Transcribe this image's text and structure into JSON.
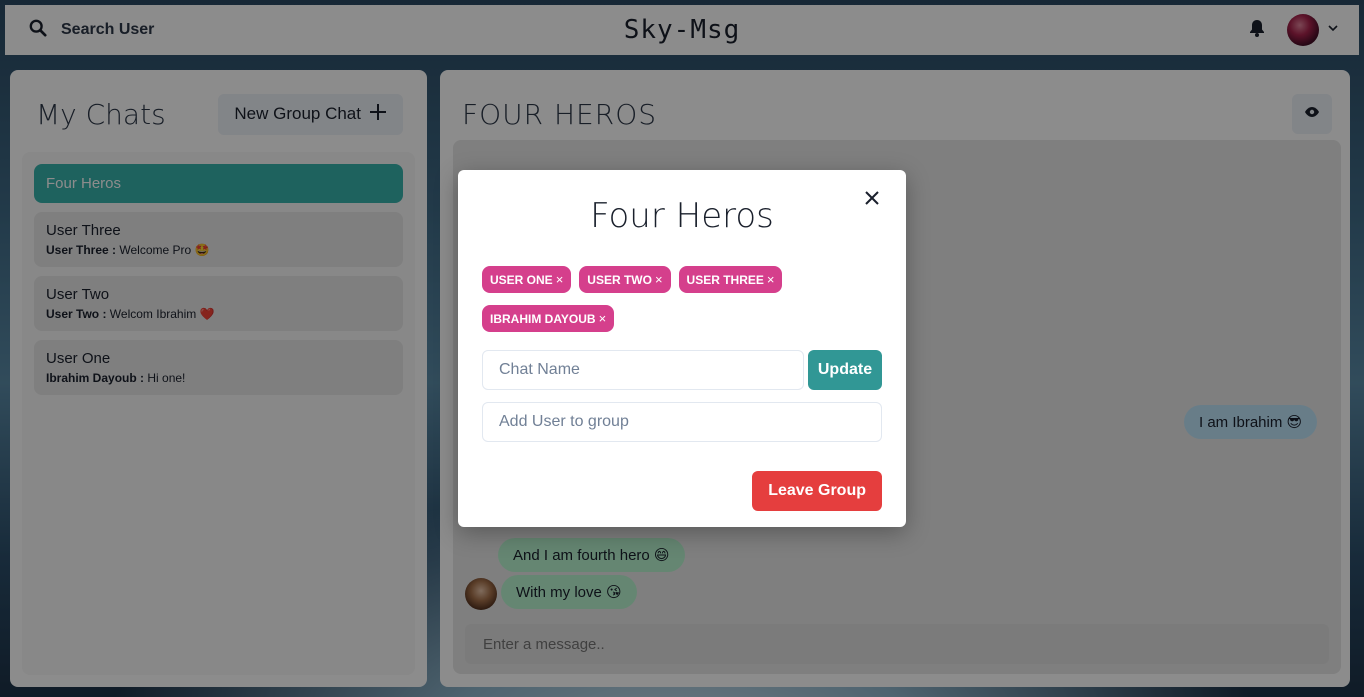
{
  "header": {
    "search_label": "Search User",
    "app_title": "Sky-Msg"
  },
  "sidebar": {
    "title": "My Chats",
    "new_group_label": "New Group Chat",
    "chats": [
      {
        "name": "Four Heros",
        "active": true,
        "sender": "",
        "preview": ""
      },
      {
        "name": "User Three",
        "sender": "User Three :",
        "preview": " Welcome Pro 🤩"
      },
      {
        "name": "User Two",
        "sender": "User Two :",
        "preview": " Welcom Ibrahim ❤️"
      },
      {
        "name": "User One",
        "sender": "Ibrahim Dayoub :",
        "preview": " Hi one!"
      }
    ]
  },
  "main": {
    "chat_title": "FOUR HEROS",
    "messages": [
      {
        "text": "I am Ibrahim 😎",
        "mine": true
      },
      {
        "text": "And I am fourth hero 😄",
        "mine": false
      },
      {
        "text": "With my love 😘",
        "mine": false
      }
    ],
    "input_placeholder": "Enter a message.."
  },
  "modal": {
    "title": "Four Heros",
    "members": [
      "USER ONE",
      "USER TWO",
      "USER THREE",
      "IBRAHIM DAYOUB"
    ],
    "remove_glyph": "×",
    "chat_name_placeholder": "Chat Name",
    "update_label": "Update",
    "add_user_placeholder": "Add User to group",
    "leave_label": "Leave Group"
  },
  "colors": {
    "accent_teal": "#38b2ac",
    "badge_pink": "#d53f8c",
    "danger_red": "#e53e3e",
    "bubble_blue": "#bee3f8",
    "bubble_green": "#b9f5d0"
  }
}
